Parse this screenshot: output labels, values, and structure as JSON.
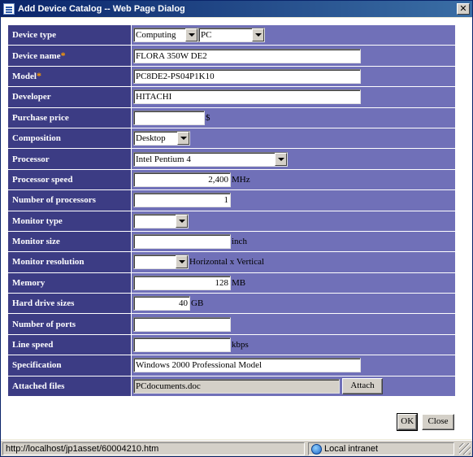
{
  "window": {
    "title": "Add Device Catalog -- Web Page Dialog",
    "close_label": "✕"
  },
  "form": {
    "device_type": {
      "label": "Device type",
      "value1": "Computing",
      "value2": "PC"
    },
    "device_name": {
      "label": "Device name",
      "required_mark": "*",
      "value": "FLORA 350W DE2"
    },
    "model": {
      "label": "Model",
      "required_mark": "*",
      "value": "PC8DE2-PS04P1K10"
    },
    "developer": {
      "label": "Developer",
      "value": "HITACHI"
    },
    "purchase_price": {
      "label": "Purchase price",
      "value": "",
      "unit": "$"
    },
    "composition": {
      "label": "Composition",
      "value": "Desktop"
    },
    "processor": {
      "label": "Processor",
      "value": "Intel Pentium 4"
    },
    "processor_speed": {
      "label": "Processor speed",
      "value": "2,400",
      "unit": "MHz"
    },
    "number_of_processors": {
      "label": "Number of processors",
      "value": "1"
    },
    "monitor_type": {
      "label": "Monitor type",
      "value": ""
    },
    "monitor_size": {
      "label": "Monitor size",
      "value": "",
      "unit": "inch"
    },
    "monitor_resolution": {
      "label": "Monitor resolution",
      "value": "",
      "unit": "Horizontal x Vertical"
    },
    "memory": {
      "label": "Memory",
      "value": "128",
      "unit": "MB"
    },
    "hard_drive_sizes": {
      "label": "Hard drive sizes",
      "value": "40",
      "unit": "GB"
    },
    "number_of_ports": {
      "label": "Number of ports",
      "value": ""
    },
    "line_speed": {
      "label": "Line speed",
      "value": "",
      "unit": "kbps"
    },
    "specification": {
      "label": "Specification",
      "value": "Windows 2000 Professional Model"
    },
    "attached_files": {
      "label": "Attached files",
      "value": "PCdocuments.doc",
      "attach_label": "Attach"
    }
  },
  "buttons": {
    "ok": "OK",
    "close": "Close"
  },
  "statusbar": {
    "url": "http://localhost/jp1asset/60004210.htm",
    "zone": "Local intranet"
  },
  "colors": {
    "label_bg": "#3c3c84",
    "field_bg": "#7070b8",
    "required": "#ff9c00"
  }
}
